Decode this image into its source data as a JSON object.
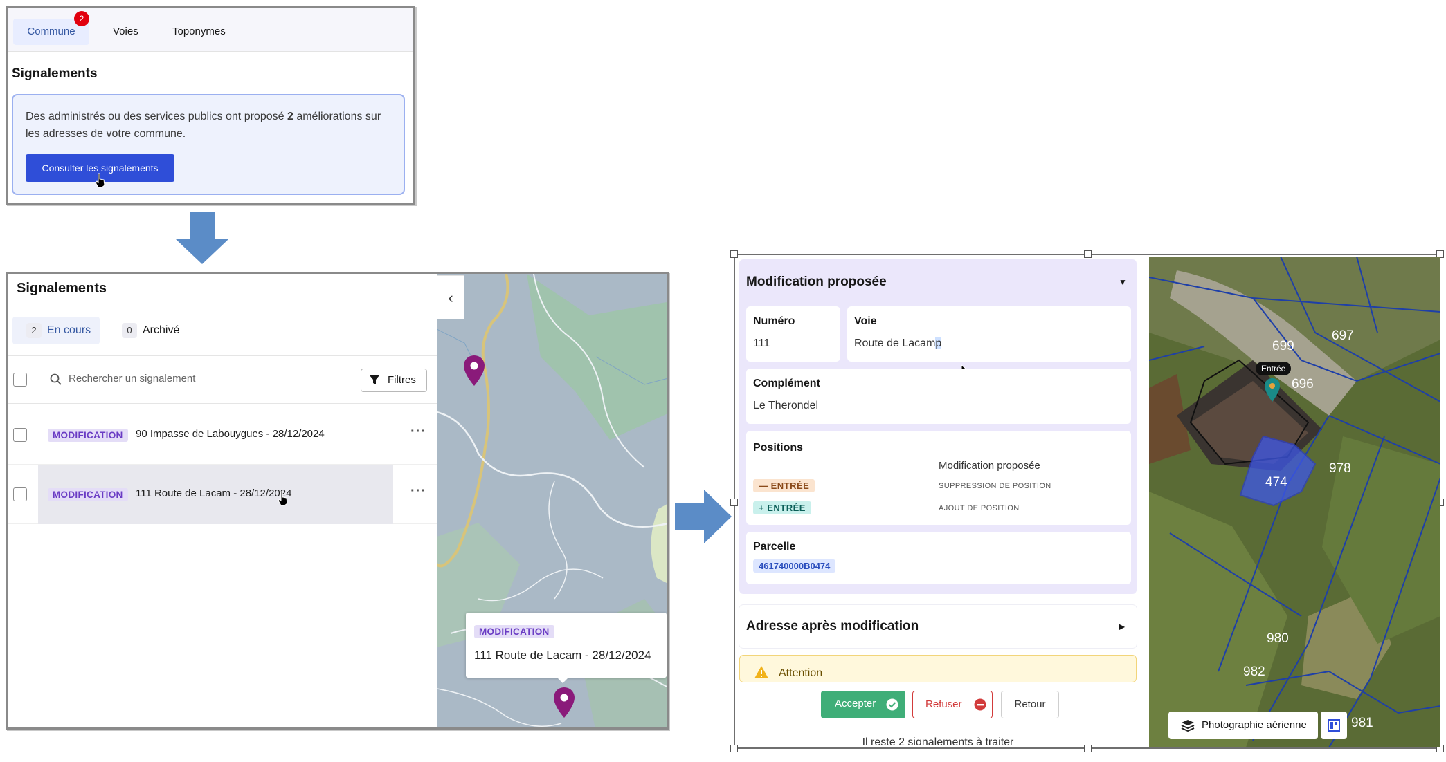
{
  "panel1": {
    "tabs": [
      {
        "label": "Commune",
        "active": true,
        "badge": "2"
      },
      {
        "label": "Voies",
        "active": false
      },
      {
        "label": "Toponymes",
        "active": false
      }
    ],
    "heading": "Signalements",
    "info_text_before": "Des administrés ou des services publics ont proposé ",
    "info_count": "2",
    "info_text_after": " améliorations sur les adresses de votre commune.",
    "button": "Consulter les signalements"
  },
  "panel2": {
    "heading": "Signalements",
    "tabs": [
      {
        "count": "2",
        "label": "En cours",
        "active": true
      },
      {
        "count": "0",
        "label": "Archivé",
        "active": false
      }
    ],
    "search_placeholder": "Rechercher un signalement",
    "filter_button": "Filtres",
    "rows": [
      {
        "tag": "MODIFICATION",
        "text": "90 Impasse de Labouygues - 28/12/2024",
        "menu": "···"
      },
      {
        "tag": "MODIFICATION",
        "text": "111 Route de Lacam - 28/12/2024",
        "menu": "···",
        "selected": true
      }
    ],
    "collapse_icon": "‹",
    "popup": {
      "tag": "MODIFICATION",
      "text": "111 Route de Lacam - 28/12/2024"
    }
  },
  "panel3": {
    "section_title": "Modification proposée",
    "numero": {
      "label": "Numéro",
      "value": "111"
    },
    "voie": {
      "label": "Voie",
      "value_main": "Route de Lacam",
      "value_highlight": "p"
    },
    "complement": {
      "label": "Complément",
      "value": "Le Therondel"
    },
    "positions": {
      "label": "Positions",
      "column_header": "Modification proposée",
      "items": [
        {
          "sign": "—",
          "type": "ENTRÉE",
          "action": "SUPPRESSION DE POSITION"
        },
        {
          "sign": "+",
          "type": "ENTRÉE",
          "action": "AJOUT DE POSITION"
        }
      ]
    },
    "parcelle": {
      "label": "Parcelle",
      "value": "461740000B0474"
    },
    "after_title": "Adresse après modification",
    "attention": "Attention",
    "buttons": {
      "accept": "Accepter",
      "refuse": "Refuser",
      "back": "Retour"
    },
    "remaining": "Il reste 2 signalements à traiter",
    "map": {
      "marker_label": "Entrée",
      "parcel_numbers": [
        "699",
        "697",
        "696",
        "978",
        "474",
        "980",
        "982",
        "981"
      ],
      "layer_button": "Photographie aérienne"
    }
  },
  "colors": {
    "primary": "#2f4ed8",
    "badge": "#e1000f",
    "modification_tag": "#6a3cc4",
    "marker": "#8a1a7a",
    "accept": "#3fae78",
    "refuse": "#d23b3b",
    "accordion_bg": "#ebe7fb",
    "arrow": "#5b8cc7"
  }
}
